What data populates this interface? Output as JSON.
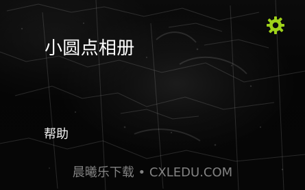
{
  "app": {
    "title": "小圆点相册"
  },
  "menu": {
    "help_label": "帮助"
  },
  "settings": {
    "icon": "gear-icon",
    "color": "#9fd21a"
  },
  "watermark": {
    "text": "晨曦乐下载 • CXLEDU.COM"
  }
}
